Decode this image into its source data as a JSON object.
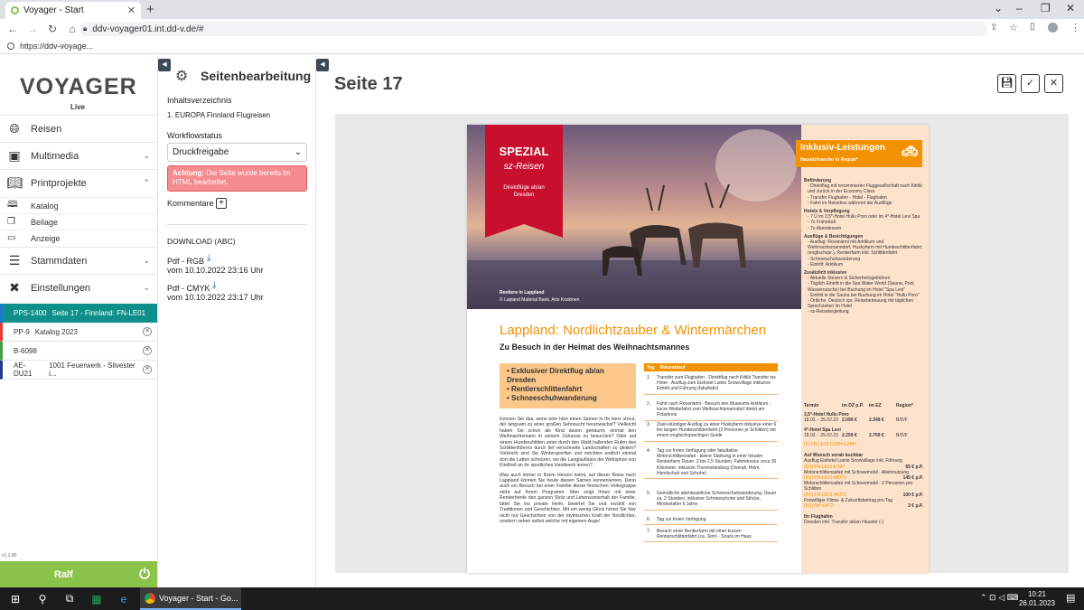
{
  "browser": {
    "tab_title": "Voyager - Start",
    "url": "ddv-voyager01.int.dd-v.de/#",
    "bookmark": "https://ddv-voyage..."
  },
  "sidebar": {
    "logo": "VOYAGER",
    "logo_sub": "Live",
    "nav": [
      {
        "label": "Reisen",
        "icon": "globe-icon"
      },
      {
        "label": "Multimedia",
        "icon": "image-icon"
      },
      {
        "label": "Printprojekte",
        "icon": "book-icon"
      },
      {
        "label": "Stammdaten",
        "icon": "database-icon"
      },
      {
        "label": "Einstellungen",
        "icon": "tools-icon"
      }
    ],
    "print_sub": [
      "Katalog",
      "Beilage",
      "Anzeige"
    ],
    "projects": [
      {
        "code": "PPS-1400",
        "name": "Seite 17 - Finnland: FN-LE01",
        "color": "#1976d2",
        "active": true
      },
      {
        "code": "PP-9",
        "name": "Katalog 2023",
        "color": "#e53935",
        "active": false
      },
      {
        "code": "B-6098",
        "name": "",
        "color": "#43a047",
        "active": false
      },
      {
        "code": "AE-DU21",
        "name": "1001 Feuerwerk - Silvester i...",
        "color": "#1e3a8a",
        "active": false
      }
    ],
    "user": "Ralf",
    "version": "v1.1.80"
  },
  "panel": {
    "title": "Seitenbearbeitung",
    "toc_label": "Inhaltsverzeichnis",
    "toc_item": "1.   EUROPA Finnland Flugreisen",
    "workflow_label": "Workflowstatus",
    "workflow_value": "Druckfreigabe",
    "alert_bold": "Achtung:",
    "alert_text": " Die Seite wurde bereits im HTML bearbeitet.",
    "comments_label": "Kommentare",
    "download_label": "DOWNLOAD (ABC)",
    "downloads": [
      {
        "name": "Pdf - RGB",
        "date": "vom 10.10.2022 23:16 Uhr"
      },
      {
        "name": "Pdf - CMYK",
        "date": "vom 10.10.2022 23:17 Uhr"
      }
    ]
  },
  "main": {
    "title": "Seite 17"
  },
  "page": {
    "spezial": "SPEZIAL",
    "brand": "sz-Reisen",
    "flights": "Direktflüge ab/an Dresden",
    "photo_caption": "Rentiere in Lappland",
    "photo_credit": "© Lapland Material Bank, Arto Koskinen",
    "headline": "Lappland: Nordlichtzauber & Wintermärchen",
    "subhead": "Zu Besuch in der Heimat des Weihnachtsmannes",
    "bullets": [
      "Exklusiver Direktflug ab/an Dresden",
      "Rentierschlittenfahrt",
      "Schneeschuhwanderung"
    ],
    "intro": "Kennen Sie das, wenn eine Idee einen Samen in Ihr Herz streut, der langsam zu einer großen Sehnsucht heranwächst? Vielleicht haben Sie schon als Kind davon geträumt, einmal den Weihnachtsmann in seinem Zuhause zu besuchen? Oder auf einem Hundeschlitten unter durch den Wald hallenden Rufen des Schlittenführers durch tief verschneite Landschaften zu gleiten? Vielleicht sind Sie Wintersportfan und möchten endlich einmal dort die Latten schnüren, wo die Langlaufstars der Weltspitze von Kindheit an ihr sportliches Handwerk lernen?",
    "intro2": "Was auch immer in Ihrem Herzen keimt, auf dieser Reise nach Lappland können Sie heute diesen Samen kennenlernen. Denn auch ein Besuch bei einer Familie dieser finnischen Volksgruppe steht auf Ihrem Programm. Man zeigt Ihnen mit einer Rentierherde den ganzen Stolz und Lebensunterhalt der Familie, bittet Sie ins private Heim, bewirtet Sie und erzählt von Traditionen und Geschichten. Mit ein wenig Glück hören Sie hier nicht nur Geschichten von der mythischen Kraft der Nordlichter, sondern sehen selbst welche mit eigenem Auge!",
    "table_head": [
      "Tag",
      "Reiseablauf"
    ],
    "days": [
      {
        "n": "1.",
        "t": "Transfer zum Flughafen - Direktflug nach Kittilä Transfer ins Hotel - Ausflug zum Eishotel Lainio Snowvillage inklusive Eintritt und Führung (fakultativ)"
      },
      {
        "n": "2.",
        "t": "Fahrt nach Rovaniemi - Besuch des Museums Arktikum - kurze Weiterfahrt zum Weihnachtsmanndorf direkt am Polarkreis"
      },
      {
        "n": "3.",
        "t": "Zwei-stündiger Ausflug zu einer Huskyfarm inklusive einer 6 km langen Hundeschlittenfahrt (2 Personen je Schlitten) mit einem englischsprachigen Guide"
      },
      {
        "n": "4.",
        "t": "Tag zur freien Verfügung oder fakultative Motorschlittensafari - kleine Stärkung in einer lokalen Rentierfarm Dauer: 2 bis 2,5 Stunden, Fahrtstrecke circa 30 Kilometer, inklusive Thermokleidung (Overall, Helm, Handschuh und Schuhe)"
      },
      {
        "n": "5.",
        "t": "Gemütliche abenteuerliche Schneeschuhwanderung, Dauer ca. 2 Stunden, inklusive Schneeschuhe und Stöcke, Mindestalter 6 Jahre"
      },
      {
        "n": "6.",
        "t": "Tag zur freien Verfügung"
      },
      {
        "n": "7.",
        "t": "Besuch einer Rentierfarm mit einer kurzen Rentierschlittenfahrt (ca. 1km) - Snack im Haus"
      }
    ],
    "side_title": "Inklusiv-Leistungen",
    "side_sub": "Haustürtransfer in Region*",
    "side_sections": [
      {
        "h": "Beförderung",
        "items": [
          "Direktflug mit renommierter Fluggesellschaft nach Kittilä und zurück in der Economy Class",
          "Transfer Flughafen - Hotel - Flughafen",
          "Fahrt im Reisebus während der Ausflüge"
        ]
      },
      {
        "h": "Hotels & Verpflegung",
        "items": [
          "7 Ü im 3,5*-Hotel Hullu Poro oder im 4*-Hotel Levi Spa",
          "7x Frühstück",
          "7x Abendessen"
        ]
      },
      {
        "h": "Ausflüge & Besichtigungen",
        "items": [
          "Ausflug: Rovaniemi mit Arktikum und Weihnachtsmanndorf, Huskyfarm mit Hundeschlittenfahrt (englischspr.), Rentierfarm inkl. Schlittenfahrt",
          "Schneeschuhwanderung",
          "Eintritt: Arktikum"
        ]
      },
      {
        "h": "Zusätzlich inklusive",
        "items": [
          "Aktuelle Steuern & Sicherheitsgebühren",
          "Täglich Eintritt in die Spa Water World (Sauna, Pool, Wasserrutsche) bei Buchung im Hotel \"Spa Levi\"",
          "Eintritt in die Sauna bei Buchung im Hotel \"Hullu Poro\"",
          "Örtliche, Deutsch spr. Reisebetreuung mit täglichen Sprechzeiten im Hotel",
          "sz-Reisebegleitung"
        ]
      }
    ],
    "price_head": [
      "Termin",
      "im DZ p.P.",
      "im EZ",
      "Region*"
    ],
    "prices": [
      {
        "hotel": "3,5*-Hotel Hullu Poro",
        "date": "18.02. - 25.02.23",
        "dz": "2.099 €",
        "ez": "2.349 €",
        "reg": "B/D/F"
      },
      {
        "hotel": "4*-Hotel Spa Levi",
        "date": "18.02. - 25.02.23",
        "dz": "2.259 €",
        "ez": "2.759 €",
        "reg": "B/D/F"
      }
    ],
    "codes": "(F) FN-LE01        DZBH        EZBH",
    "extras_title": "Auf Wunsch vorab buchbar",
    "extras": [
      {
        "t": "Ausflug Eishotel Lainio Snowvillage inkl. Führung",
        "code": "(EX) FN-LE01-EISH",
        "p": "65 € p.P."
      },
      {
        "t": "Motorschlittensafari mit Schneemobil - Alleinnutzung",
        "code": "(EX) FN-LE01-MOT1",
        "p": "145 € p.P."
      },
      {
        "t": "Motorschlittensafari mit Schneemobil - 2 Personen pro Schlitten",
        "code": "(EX) FN-LE01-MOT2",
        "p": "100 € p.P."
      },
      {
        "t": "Freiwilliger Klima- & Zukunftsbeitrag pro Tag",
        "code": "(EX) NH-KAT2",
        "p": "3 € p.P."
      }
    ],
    "flights_title": "Ihr Flughafen",
    "flights_text": "Dresden inkl. Transfer ab/an Haustür (-)"
  },
  "taskbar": {
    "app_label": "Voyager - Start - Go...",
    "time": "10:21",
    "date": "26.01.2023"
  }
}
